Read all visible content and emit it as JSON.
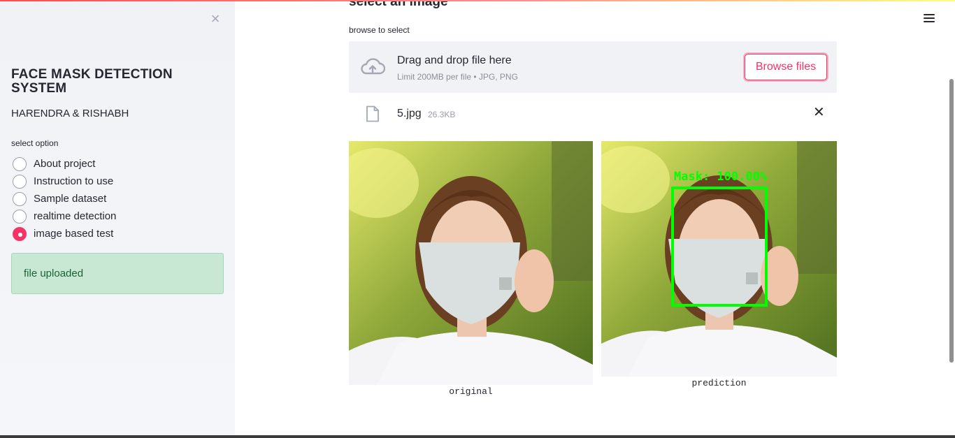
{
  "sidebar": {
    "close_icon": "close-icon",
    "title": "FACE MASK DETECTION SYSTEM",
    "authors": "HARENDRA & RISHABH",
    "select_label": "select option",
    "options": [
      {
        "label": "About project",
        "selected": false
      },
      {
        "label": "Instruction to use",
        "selected": false
      },
      {
        "label": "Sample dataset",
        "selected": false
      },
      {
        "label": "realtime detection",
        "selected": false
      },
      {
        "label": "image based test",
        "selected": true
      }
    ],
    "status": "file uploaded"
  },
  "main": {
    "heading": "select an image",
    "uploader": {
      "label": "browse to select",
      "drop_title": "Drag and drop file here",
      "limit": "Limit 200MB per file • JPG, PNG",
      "browse_button": "Browse files"
    },
    "file": {
      "name": "5.jpg",
      "size": "26.3KB"
    },
    "images": [
      {
        "caption": "original"
      },
      {
        "caption": "prediction",
        "detection_label": "Mask: 100.00%"
      }
    ]
  },
  "colors": {
    "accent": "#f63366",
    "success_bg": "#c8e8d3",
    "detection_box": "#00ff00"
  }
}
